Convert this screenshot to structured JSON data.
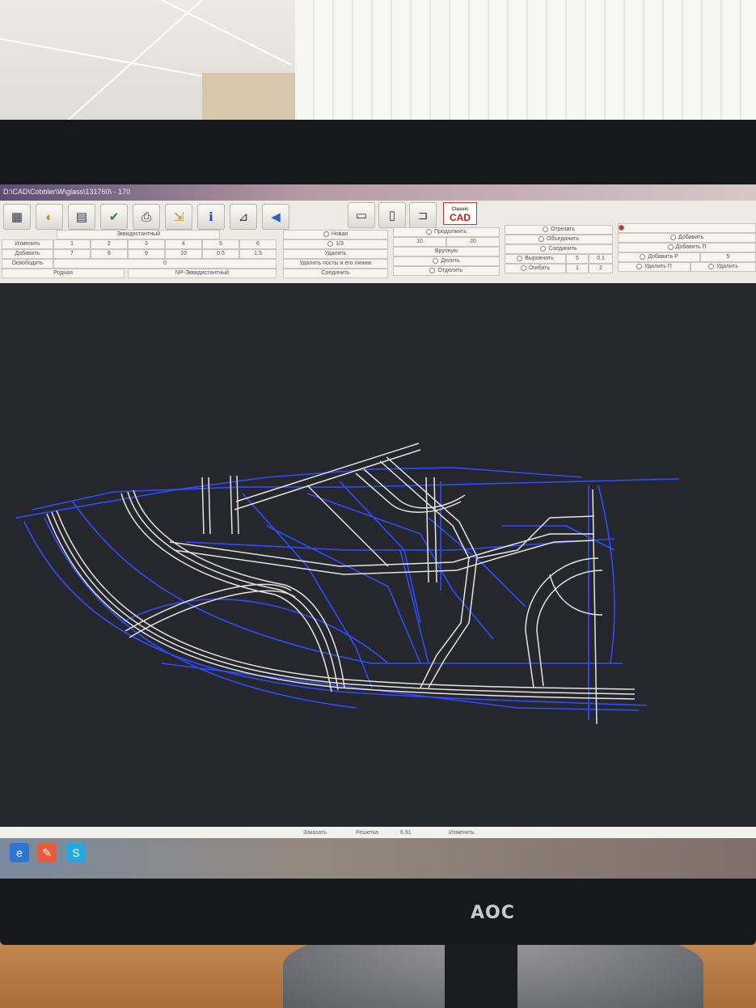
{
  "window": {
    "title": "D:\\CAD\\Cobbler\\W\\glass\\131760\\ - 170"
  },
  "toolbar": {
    "left_icons": [
      "table-icon",
      "paint-icon",
      "chart-icon",
      "check-icon",
      "print-icon",
      "export-icon",
      "info-icon",
      "ruler-icon",
      "back-arrow-icon"
    ],
    "right_icons": [
      "save-icon",
      "save-as-icon",
      "door-icon"
    ],
    "logo_small": "Classic",
    "logo_big": "CAD"
  },
  "equidistant_panel": {
    "header": "Эквидистантный",
    "rows": [
      {
        "label": "Изменить",
        "values": [
          "1",
          "2",
          "3",
          "4",
          "5",
          "6"
        ]
      },
      {
        "label": "Добавить",
        "values": [
          "7",
          "8",
          "9",
          "10",
          "0.5",
          "1.5"
        ]
      },
      {
        "label": "Освободить",
        "values": [
          "0"
        ]
      }
    ],
    "footer_left": "Родная",
    "footer_right": "NP-Эквидистантный"
  },
  "new_panel": {
    "items": [
      "Новая",
      "1/3",
      "Удалить",
      "Удалить посты и его линию",
      "Соединить"
    ]
  },
  "continue_panel": {
    "header": "Продолжить",
    "values": [
      "10",
      "20"
    ],
    "items": [
      "Вручную",
      "Делить",
      "Отделить"
    ]
  },
  "cut_panel": {
    "items": [
      "Отрезать",
      "Объединить",
      "Соединить",
      "Выровнять",
      "Огибать"
    ],
    "align_values": [
      "5",
      "0.1"
    ],
    "wrap_values": [
      "1",
      "2"
    ]
  },
  "add_panel": {
    "items": [
      "Добавить",
      "Добавить П",
      "Добавить Р",
      "Удалить П"
    ],
    "values": [
      "5"
    ],
    "delete_label": "Удалить"
  },
  "statusbar": {
    "items": [
      "Заказать",
      "Решетка",
      "6.91",
      "Изменить"
    ]
  },
  "taskbar": {
    "icons": [
      "internet-explorer-icon",
      "paint-app-icon",
      "skype-icon"
    ]
  },
  "monitor": {
    "brand": "AOC"
  },
  "colors": {
    "canvas": "#26272c",
    "outline_blue": "#2f4dff",
    "outline_white": "#e6e3e1",
    "logo_red": "#c31d1d"
  }
}
